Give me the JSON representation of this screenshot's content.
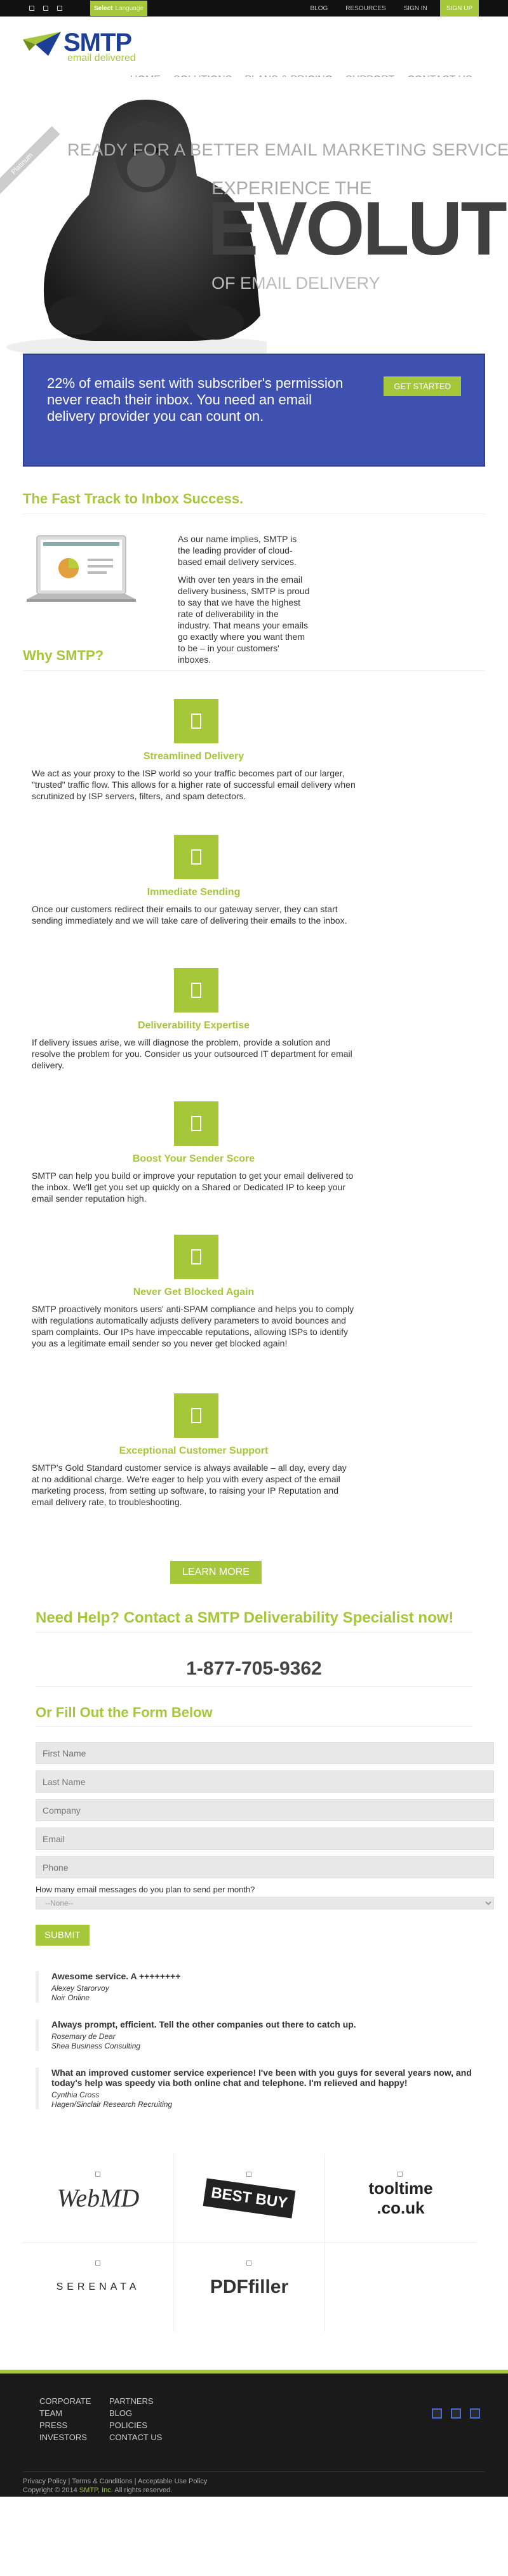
{
  "topbar": {
    "lang_label": "Select",
    "lang_value": "Language",
    "links": [
      "BLOG",
      "RESOURCES",
      "SIGN IN",
      "SIGN UP"
    ]
  },
  "logo": {
    "name": "SMTP",
    "tagline": "email delivered"
  },
  "nav": [
    "HOME",
    "SOLUTIONS",
    "PLANS & PRICING",
    "SUPPORT",
    "CONTACT US"
  ],
  "hero": {
    "ribbon": "Platinum",
    "line1": "READY FOR A BETTER EMAIL MARKETING SERVICE?",
    "line2": "EXPERIENCE THE",
    "line3": "EVOLUTION",
    "line4": "OF EMAIL DELIVERY"
  },
  "banner": {
    "text": "22% of emails sent with subscriber's permission never reach their inbox. You need an email delivery provider you can count on.",
    "cta": "GET STARTED"
  },
  "track": {
    "title": "The Fast Track to Inbox Success.",
    "p1": "As our name implies, SMTP is the leading provider of cloud-based email delivery services.",
    "p2": "With over ten years in the email delivery business, SMTP is proud to say that we have the highest rate of deliverability in the industry. That means your emails go exactly where you want them to be – in your customers' inboxes."
  },
  "why": {
    "title": "Why SMTP?",
    "features": [
      {
        "title": "Streamlined Delivery",
        "text": "We act as your proxy to the ISP world so your traffic becomes part of our larger, \"trusted\" traffic flow. This allows for a higher rate of successful email delivery when scrutinized by ISP servers, filters, and spam detectors."
      },
      {
        "title": "Immediate Sending",
        "text": "Once our customers redirect their emails to our gateway server, they can start sending immediately and we will take care of delivering their emails to the inbox."
      },
      {
        "title": "Deliverability Expertise",
        "text": "If delivery issues arise, we will diagnose the problem, provide a solution and resolve the problem for you. Consider us your outsourced IT department for email delivery."
      },
      {
        "title": "Boost Your Sender Score",
        "text": "SMTP can help you build or improve your reputation to get your email delivered to the inbox. We'll get you set up quickly on a Shared or Dedicated IP to keep your email sender reputation high."
      },
      {
        "title": "Never Get Blocked Again",
        "text": "SMTP proactively monitors users' anti-SPAM compliance and helps you to comply with regulations automatically adjusts delivery parameters to avoid bounces and spam complaints. Our IPs have impeccable reputations, allowing ISPs to identify you as a legitimate email sender so you never get blocked again!"
      },
      {
        "title": "Exceptional Customer Support",
        "text": "SMTP's Gold Standard customer service is always available – all day, every day at no additional charge. We're eager to help you with every aspect of the email marketing process, from setting up software, to raising your IP Reputation and email delivery rate, to troubleshooting."
      }
    ],
    "learn_more": "LEARN MORE"
  },
  "help": {
    "title": "Need Help? Contact a SMTP Deliverability Specialist now!",
    "phone": "1-877-705-9362",
    "form_title": "Or Fill Out the Form Below"
  },
  "form": {
    "first_name": "First Name",
    "last_name": "Last Name",
    "company": "Company",
    "email": "Email",
    "phone": "Phone",
    "question": "How many email messages do you plan to send per month?",
    "select_value": "--None--",
    "submit": "SUBMIT"
  },
  "testimonials": [
    {
      "quote": "Awesome service. A ++++++++",
      "name": "Alexey Starorvoy",
      "company": "Noir Online"
    },
    {
      "quote": "Always prompt, efficient. Tell the other companies out there to catch up.",
      "name": "Rosemary de Dear",
      "company": "Shea Business Consulting"
    },
    {
      "quote": "What an improved customer service experience! I've been with you guys for several years now, and today's help was speedy via both online chat and telephone. I'm relieved and happy!",
      "name": "Cynthia Cross",
      "company": "Hagen/Sinclair Research Recruiting"
    }
  ],
  "clients": [
    "WebMD",
    "BEST BUY",
    "tooltime .co.uk",
    "SERENATA",
    "PDFfiller"
  ],
  "footer": {
    "links": [
      "CORPORATE",
      "PARTNERS",
      "TEAM",
      "BLOG",
      "PRESS",
      "POLICIES",
      "INVESTORS",
      "CONTACT US"
    ],
    "legal1": "Privacy Policy | Terms & Conditions | Acceptable Use Policy",
    "legal2a": "Copyright © 2014",
    "legal2b": "SMTP, Inc.",
    "legal2c": "All rights reserved."
  },
  "colors": {
    "accent": "#a6c73a",
    "brand": "#1c3f95",
    "banner": "#3f51b0"
  }
}
